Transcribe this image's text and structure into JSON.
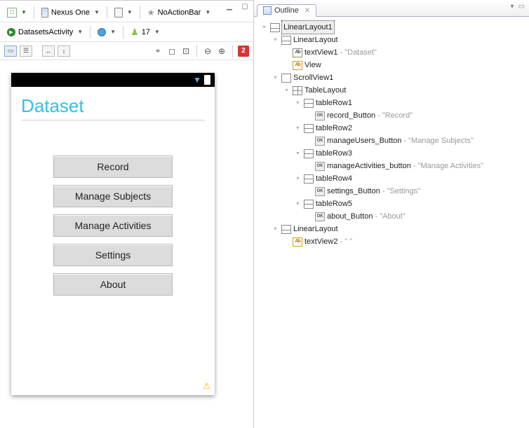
{
  "toolbar1": {
    "config_label": "",
    "device_label": "Nexus One",
    "theme_label": "NoActionBar"
  },
  "toolbar2": {
    "activity_label": "DatasetsActivity",
    "api_label": "17"
  },
  "error_count": "2",
  "preview": {
    "title": "Dataset",
    "buttons": [
      "Record",
      "Manage Subjects",
      "Manage Activities",
      "Settings",
      "About"
    ]
  },
  "outline": {
    "tab_title": "Outline",
    "tree": {
      "root": "LinearLayout1",
      "ll1": "LinearLayout",
      "tv1": "textView1",
      "tv1_extra": " - \"Dataset\"",
      "view": "View",
      "scroll": "ScrollView1",
      "table": "TableLayout",
      "r1": "tableRow1",
      "b1": "record_Button",
      "b1_extra": " - \"Record\"",
      "r2": "tableRow2",
      "b2": "manageUsers_Button",
      "b2_extra": " - \"Manage Subjects\"",
      "r3": "tableRow3",
      "b3": "manageActivities_button",
      "b3_extra": " - \"Manage Activities\"",
      "r4": "tableRow4",
      "b4": "settings_Button",
      "b4_extra": " - \"Settings\"",
      "r5": "tableRow5",
      "b5": "about_Button",
      "b5_extra": " - \"About\"",
      "ll2": "LinearLayout",
      "tv2": "textView2",
      "tv2_extra": " - \" \""
    }
  }
}
